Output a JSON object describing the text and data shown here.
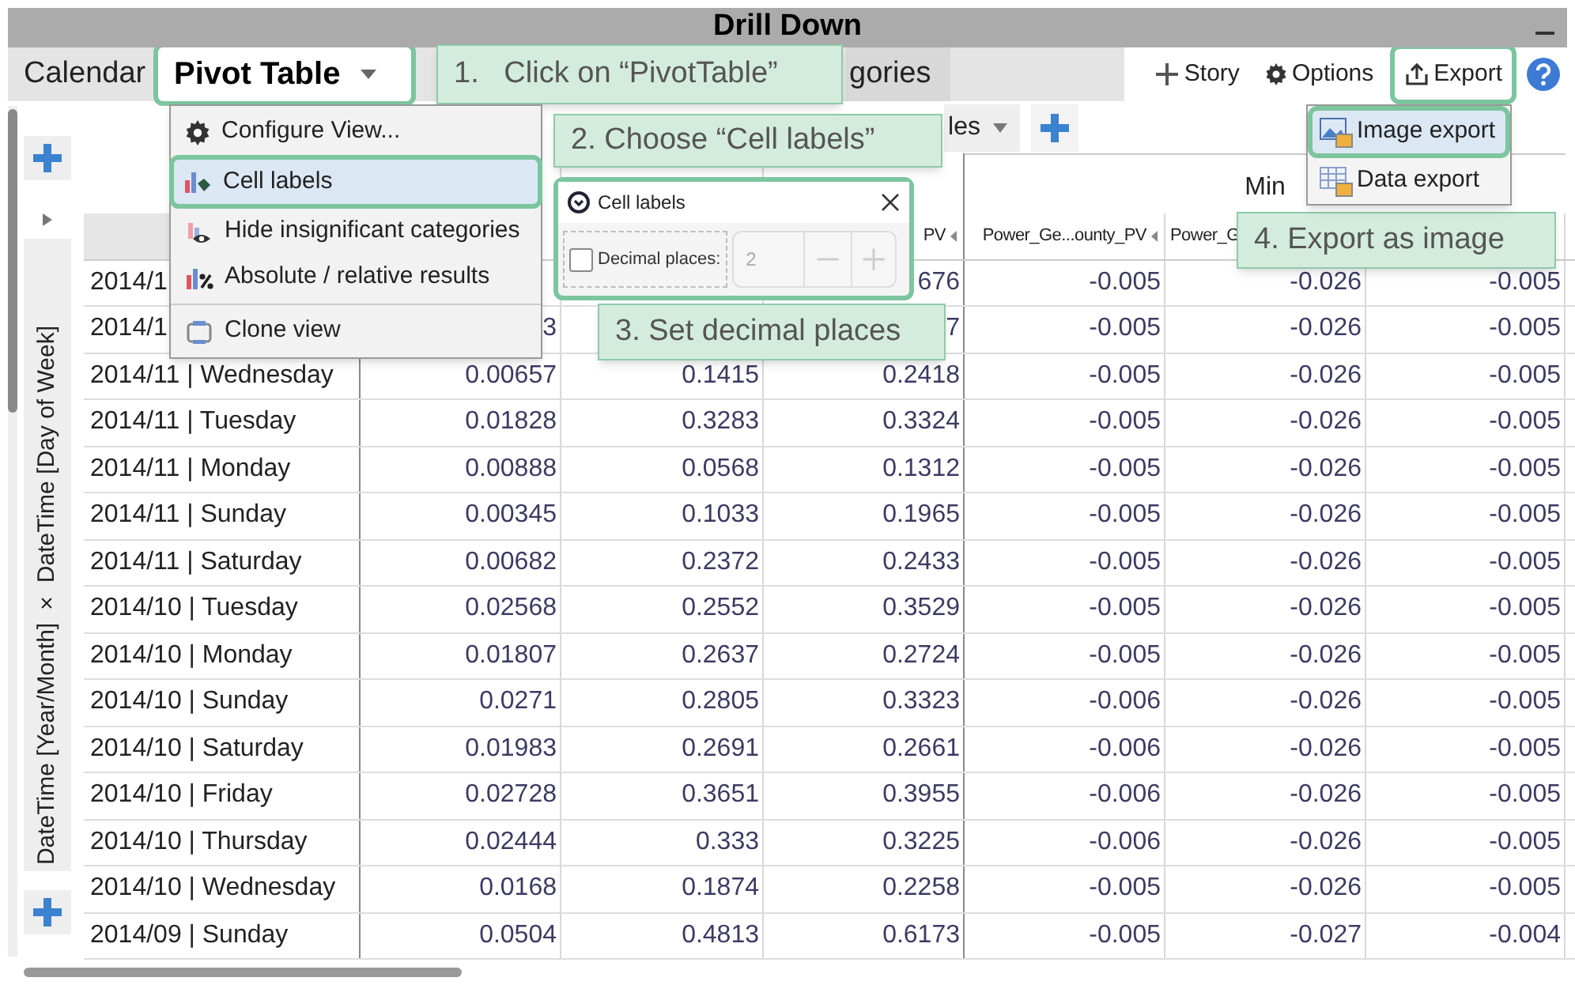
{
  "window": {
    "title": "Drill Down"
  },
  "tabs": [
    {
      "label": "Calendar",
      "selected": false,
      "highlighted": false
    },
    {
      "label": "Pivot Table",
      "selected": true,
      "highlighted": true,
      "dropdown": true
    },
    {
      "label": "gories",
      "selected": false,
      "highlighted": false
    }
  ],
  "toolbar": [
    {
      "kind": "add",
      "label": "Story",
      "highlighted": false
    },
    {
      "kind": "gear",
      "label": "Options",
      "highlighted": false
    },
    {
      "kind": "export",
      "label": "Export",
      "highlighted": true
    },
    {
      "kind": "help",
      "highlighted": false
    }
  ],
  "view_toolbar": {
    "dropdown_label": "les"
  },
  "row_axis": {
    "label": "DateTime [Year/Month] × DateTime [Day of Week]"
  },
  "table": {
    "group_header": "Min",
    "columns": [
      null,
      null,
      {
        "label": "PV",
        "sort_arrow": true
      },
      {
        "label": "Power_Ge...ounty_PV",
        "sort_arrow": true
      },
      {
        "label": "Power_G",
        "sort_arrow": false
      },
      null
    ],
    "rows": [
      {
        "label": "2014/1",
        "cells": [
          null,
          null,
          "676",
          "-0.005",
          "-0.026",
          "-0.005"
        ]
      },
      {
        "label": "2014/1",
        "cells": [
          "3",
          null,
          "7",
          "-0.005",
          "-0.026",
          "-0.005"
        ]
      },
      {
        "label": "2014/11 | Wednesday",
        "cells": [
          "0.00657",
          "0.1415",
          "0.2418",
          "-0.005",
          "-0.026",
          "-0.005"
        ]
      },
      {
        "label": "2014/11 | Tuesday",
        "cells": [
          "0.01828",
          "0.3283",
          "0.3324",
          "-0.005",
          "-0.026",
          "-0.005"
        ]
      },
      {
        "label": "2014/11 | Monday",
        "cells": [
          "0.00888",
          "0.0568",
          "0.1312",
          "-0.005",
          "-0.026",
          "-0.005"
        ]
      },
      {
        "label": "2014/11 | Sunday",
        "cells": [
          "0.00345",
          "0.1033",
          "0.1965",
          "-0.005",
          "-0.026",
          "-0.005"
        ]
      },
      {
        "label": "2014/11 | Saturday",
        "cells": [
          "0.00682",
          "0.2372",
          "0.2433",
          "-0.005",
          "-0.026",
          "-0.005"
        ]
      },
      {
        "label": "2014/10 | Tuesday",
        "cells": [
          "0.02568",
          "0.2552",
          "0.3529",
          "-0.005",
          "-0.026",
          "-0.005"
        ]
      },
      {
        "label": "2014/10 | Monday",
        "cells": [
          "0.01807",
          "0.2637",
          "0.2724",
          "-0.005",
          "-0.026",
          "-0.005"
        ]
      },
      {
        "label": "2014/10 | Sunday",
        "cells": [
          "0.0271",
          "0.2805",
          "0.3323",
          "-0.006",
          "-0.026",
          "-0.005"
        ]
      },
      {
        "label": "2014/10 | Saturday",
        "cells": [
          "0.01983",
          "0.2691",
          "0.2661",
          "-0.006",
          "-0.026",
          "-0.005"
        ]
      },
      {
        "label": "2014/10 | Friday",
        "cells": [
          "0.02728",
          "0.3651",
          "0.3955",
          "-0.006",
          "-0.026",
          "-0.005"
        ]
      },
      {
        "label": "2014/10 | Thursday",
        "cells": [
          "0.02444",
          "0.333",
          "0.3225",
          "-0.006",
          "-0.026",
          "-0.005"
        ]
      },
      {
        "label": "2014/10 | Wednesday",
        "cells": [
          "0.0168",
          "0.1874",
          "0.2258",
          "-0.005",
          "-0.026",
          "-0.005"
        ]
      },
      {
        "label": "2014/09 | Sunday",
        "cells": [
          "0.0504",
          "0.4813",
          "0.6173",
          "-0.005",
          "-0.027",
          "-0.004"
        ]
      }
    ]
  },
  "view_menu": {
    "items": [
      {
        "kind": "gear",
        "label": "Configure View...",
        "selected": false,
        "highlighted": false
      },
      {
        "kind": "cell-labels",
        "label": "Cell labels",
        "selected": true,
        "highlighted": true
      },
      {
        "kind": "hide",
        "label": "Hide insignificant categories",
        "selected": false,
        "highlighted": false
      },
      {
        "kind": "percent",
        "label": "Absolute / relative results",
        "selected": false,
        "highlighted": false
      },
      {
        "kind": "clone",
        "label": "Clone view",
        "selected": false,
        "highlighted": false,
        "separator_before": true
      }
    ]
  },
  "cell_labels_dialog": {
    "title": "Cell labels",
    "highlighted": true,
    "checkbox_label": "Decimal places:",
    "checked": false,
    "value": "2",
    "disabled": true
  },
  "export_menu": {
    "items": [
      {
        "kind": "image",
        "label": "Image export",
        "selected": true,
        "highlighted": true
      },
      {
        "kind": "data",
        "label": "Data export",
        "selected": false,
        "highlighted": false
      }
    ]
  },
  "callouts": [
    {
      "text": "1.   Click on “PivotTable”"
    },
    {
      "text": "2. Choose “Cell labels”"
    },
    {
      "text": "3. Set decimal places"
    },
    {
      "text": "4. Export as image"
    }
  ]
}
